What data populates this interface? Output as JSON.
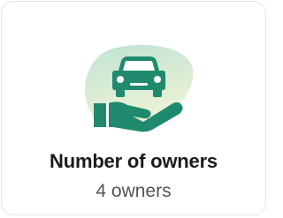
{
  "card": {
    "title": "Number of owners",
    "value": "4 owners",
    "icon": "car-in-hand-icon"
  },
  "colors": {
    "accent": "#1f8a6e",
    "blob_top": "#bfe3d3",
    "blob_bottom": "#eaf2d5",
    "title": "#1c1c1c",
    "value": "#555555"
  }
}
